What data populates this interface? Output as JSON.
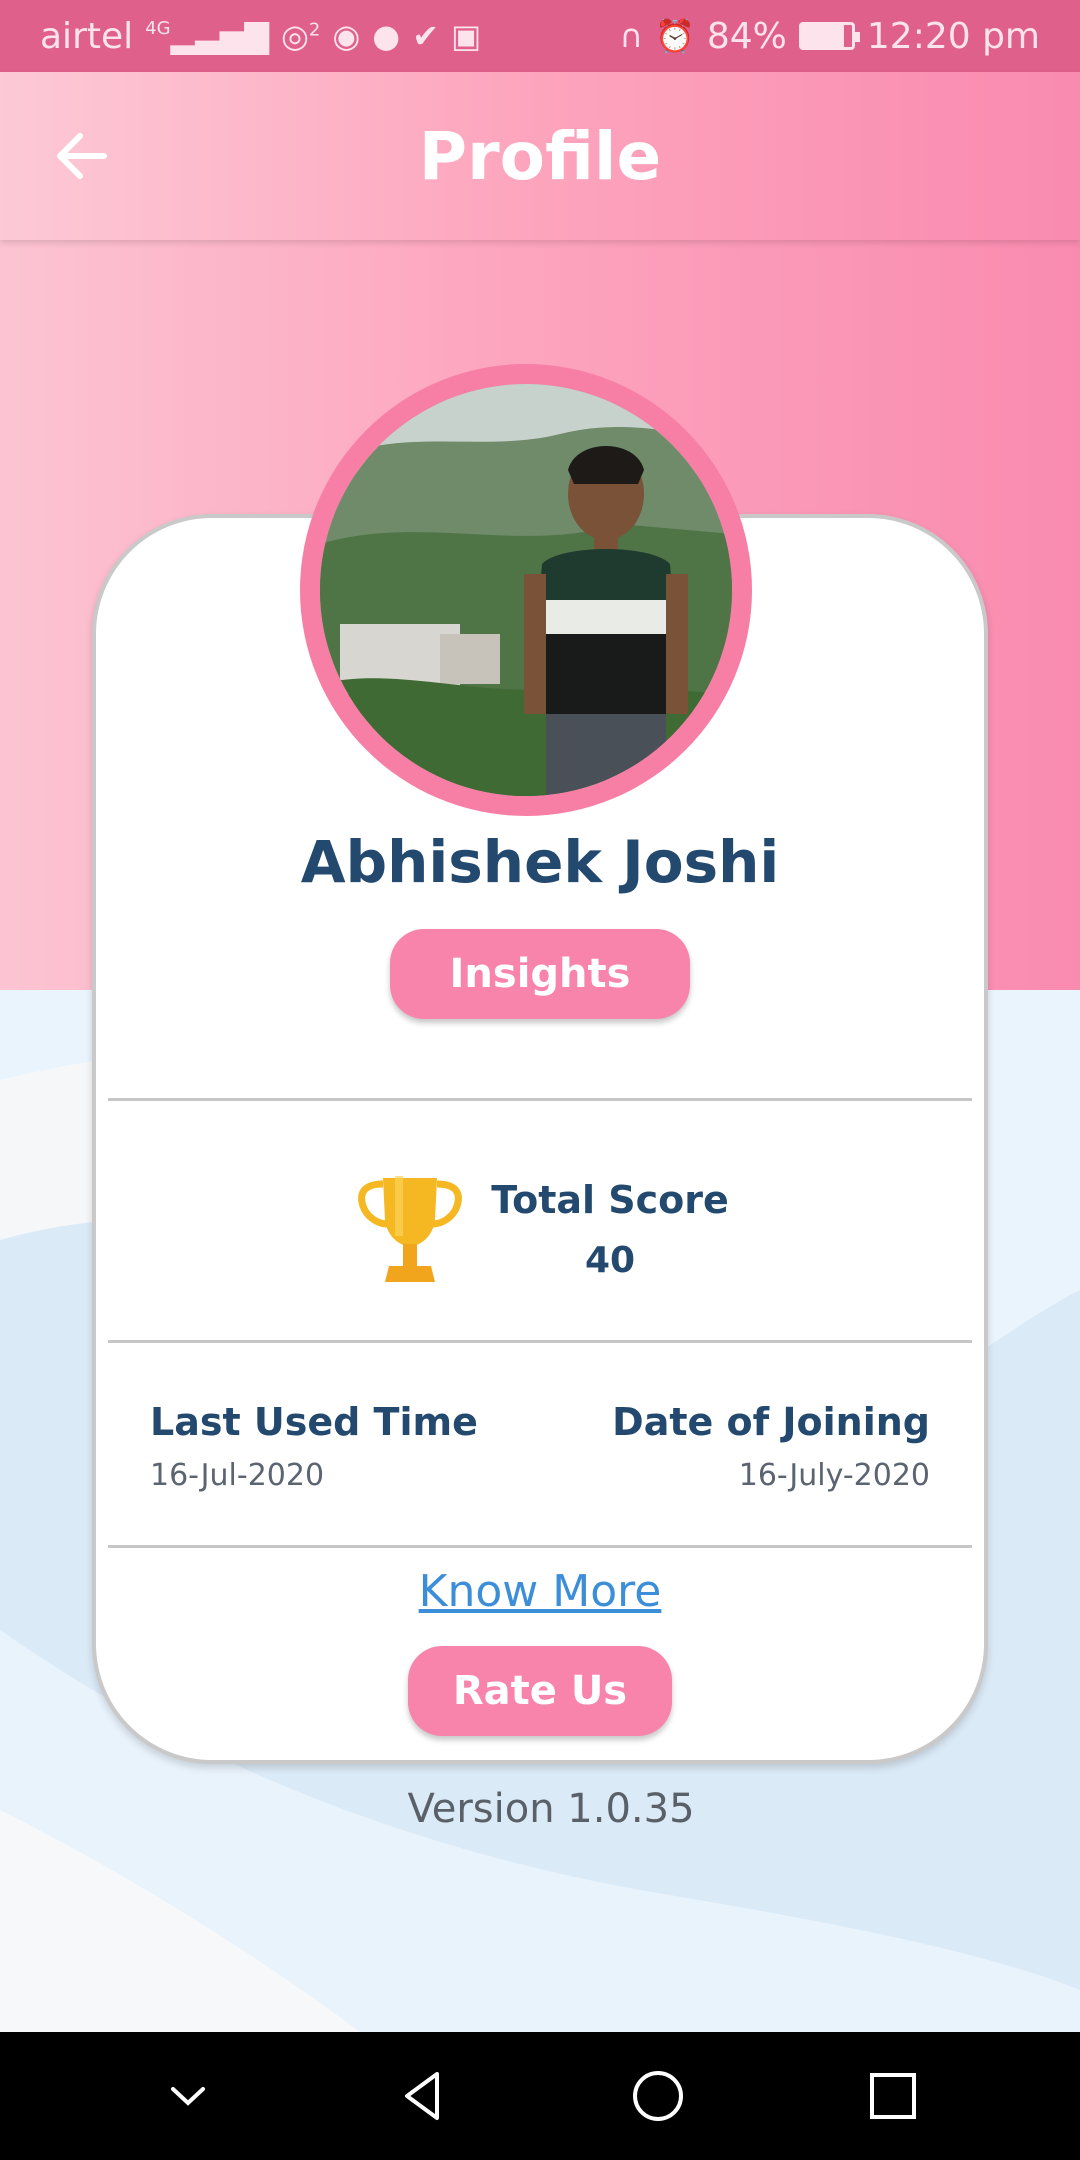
{
  "status_bar": {
    "carrier": "airtel",
    "network": "4G",
    "hotspot_count": "2",
    "battery_text": "84%",
    "battery_level": 0.84,
    "time": "12:20 pm"
  },
  "header": {
    "title": "Profile",
    "back_icon": "arrow-left-icon"
  },
  "profile": {
    "name": "Abhishek Joshi",
    "insights_label": "Insights",
    "score_label": "Total Score",
    "score_value": "40",
    "last_used_label": "Last Used Time",
    "last_used_value": "16-Jul-2020",
    "joining_label": "Date of Joining",
    "joining_value": "16-July-2020",
    "know_more_label": "Know More",
    "rate_us_label": "Rate Us"
  },
  "footer": {
    "version": "Version 1.0.35"
  },
  "colors": {
    "status_bar": "#e0608c",
    "accent_pink": "#f884ac",
    "text_navy": "#23496e",
    "link_blue": "#3c8ed8"
  }
}
